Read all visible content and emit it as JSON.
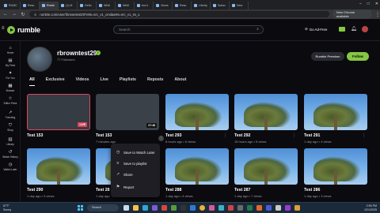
{
  "browser": {
    "tabs": [
      "RUMC",
      "Resu",
      "Rumb",
      "(1) M",
      "Getin",
      "Wildl",
      "Wildl",
      "bra h",
      "Views",
      "Resu",
      "Liberty",
      "Subsc",
      "New"
    ],
    "url": "rumble.com/user/rbrowntest29?e9s=src_v1_cmd&e9s=src_v1_ss_u",
    "new_chrome_label": "New Chrome available"
  },
  "header": {
    "logo": "rumble",
    "search_placeholder": "Search",
    "go_ad_free": "Go Ad-Free"
  },
  "sidebar": {
    "items": [
      {
        "label": "Home",
        "icon": "home-icon"
      },
      {
        "label": "My Feed",
        "icon": "feed-icon"
      },
      {
        "label": "For You",
        "icon": "for-you-icon"
      },
      {
        "label": "Browse",
        "icon": "browse-icon"
      },
      {
        "label": "Editor Picks",
        "icon": "star-icon"
      },
      {
        "label": "Trending",
        "icon": "trending-icon"
      },
      {
        "label": "Shop",
        "icon": "shop-icon"
      },
      {
        "label": "Library",
        "icon": "library-icon"
      },
      {
        "label": "Watch History",
        "icon": "history-icon"
      },
      {
        "label": "Watch Later",
        "icon": "clock-icon"
      }
    ]
  },
  "channel": {
    "name": "rbrowntest29",
    "followers": "77 Followers",
    "premium_label": "Rumble Premium",
    "follow_label": "Follow"
  },
  "tabs": [
    "All",
    "Exclusive",
    "Videos",
    "Live",
    "Playlists",
    "Reposts",
    "About"
  ],
  "videos": [
    {
      "title": "Test 153",
      "meta": "",
      "badge": "LIVE",
      "kind": "live"
    },
    {
      "title": "Test 153",
      "meta": "7 minutes ago",
      "badge": "07:48",
      "kind": "gray"
    },
    {
      "title": "Test 293",
      "meta": "6 hours ago • 6 views",
      "badge": "",
      "kind": "palm"
    },
    {
      "title": "Test 292",
      "meta": "15 hours ago • 5 views",
      "badge": "",
      "kind": "palm"
    },
    {
      "title": "Test 291",
      "meta": "1 day ago • 4 views",
      "badge": "",
      "kind": "palm"
    },
    {
      "title": "Test 290",
      "meta": "1 day ago • 5 views",
      "badge": "",
      "kind": "palm"
    },
    {
      "title": "Test 28",
      "meta": "1 day ago",
      "badge": "",
      "kind": "palm"
    },
    {
      "title": "Test 288",
      "meta": "1 day ago • 4 views",
      "badge": "",
      "kind": "palm"
    },
    {
      "title": "Test 287",
      "meta": "1 day ago • 7 views",
      "badge": "",
      "kind": "palm"
    },
    {
      "title": "Test 286",
      "meta": "1 day ago • 3 views",
      "badge": "",
      "kind": "palm"
    }
  ],
  "context_menu": {
    "items": [
      {
        "label": "Save to Watch Later",
        "icon": "clock-icon"
      },
      {
        "label": "Save to playlist",
        "icon": "playlist-icon"
      },
      {
        "label": "Share",
        "icon": "share-icon"
      },
      {
        "label": "Report",
        "icon": "flag-icon"
      }
    ]
  },
  "taskbar": {
    "weather_temp": "87°F",
    "weather_desc": "Sunny",
    "search_label": "Search",
    "time": "2:55 PM",
    "date": "12/1/2025"
  }
}
